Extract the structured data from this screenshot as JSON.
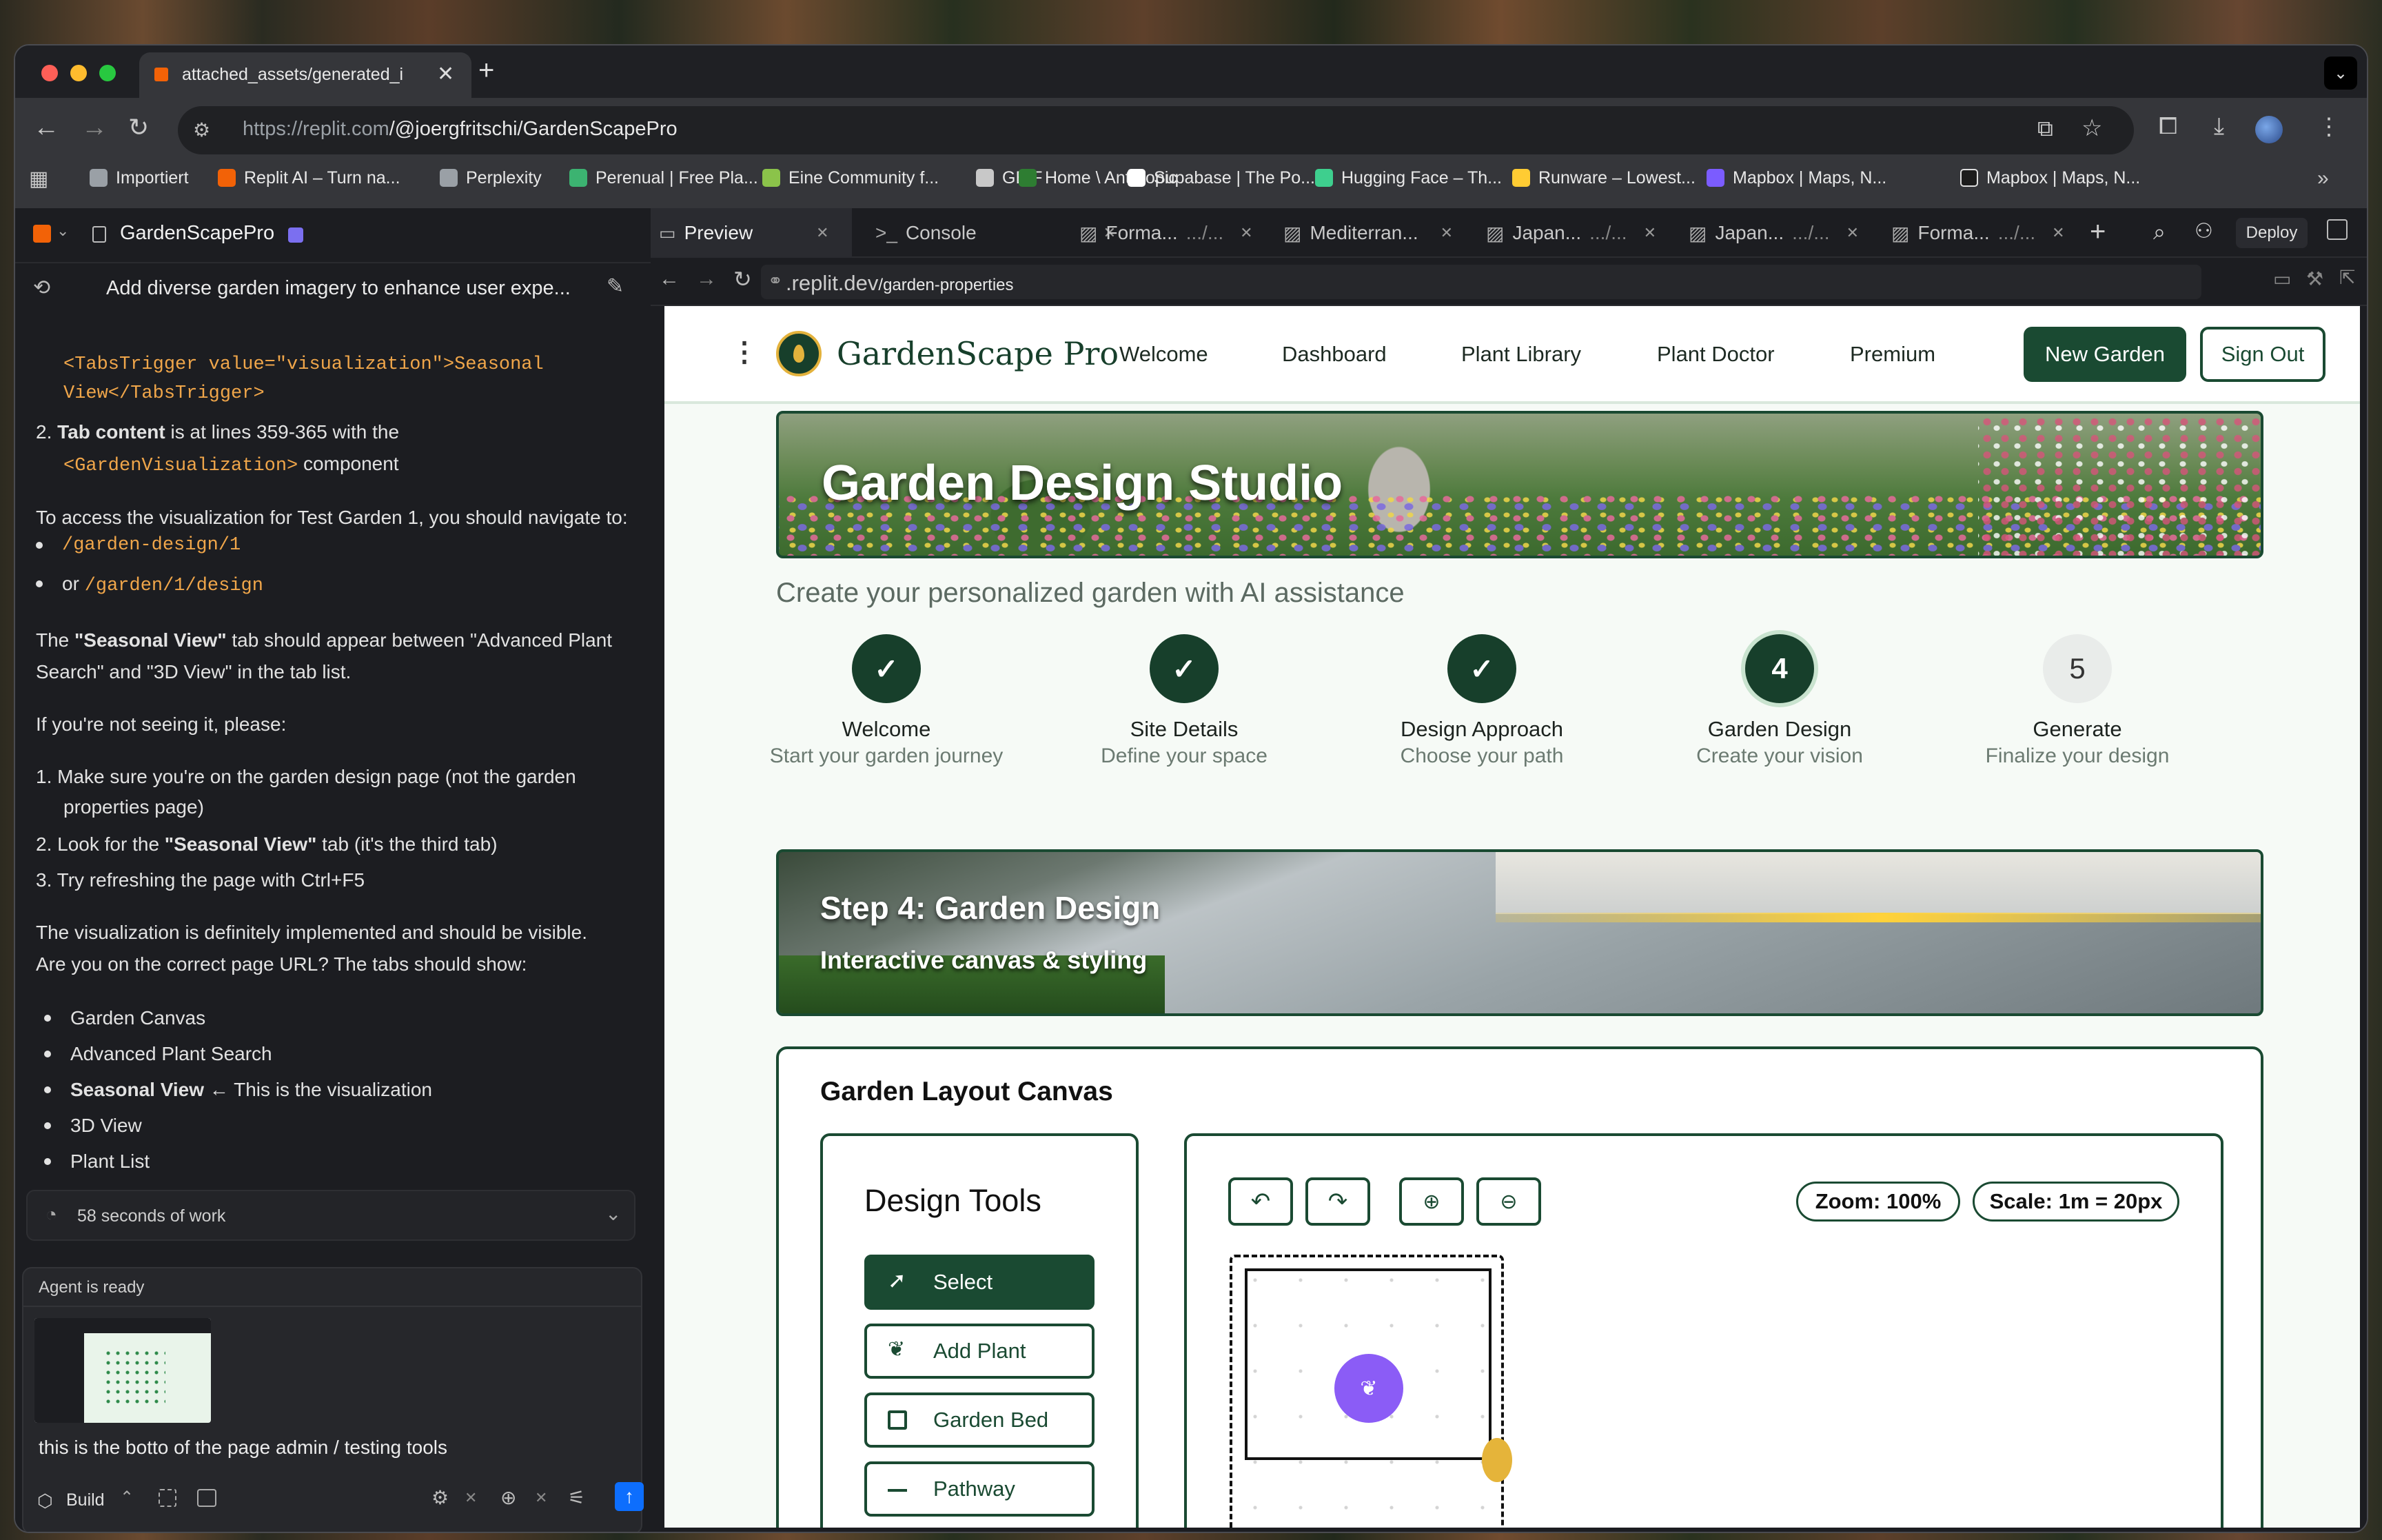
{
  "browser": {
    "tab_title": "attached_assets/generated_i",
    "url_host": "https://replit.com",
    "url_path": "/@joergfritschi/GardenScapePro",
    "bookmarks": [
      "Importiert",
      "Replit AI – Turn na...",
      "Perplexity",
      "Perenual | Free Pla...",
      "Eine Community f...",
      "GBIF",
      "Home \\ Anthropic",
      "Supabase | The Po...",
      "Hugging Face – Th...",
      "Runware – Lowest...",
      "Mapbox | Maps, N..."
    ]
  },
  "workspace": {
    "project_name": "GardenScapePro",
    "chat_title": "Add diverse garden imagery to enhance user expe...",
    "tabs": [
      {
        "label": "Preview"
      },
      {
        "label": "Console"
      },
      {
        "label": "Forma...",
        "suffix": ".../..."
      },
      {
        "label": "Mediterran..."
      },
      {
        "label": "Japan...",
        "suffix": ".../..."
      },
      {
        "label": "Japan...",
        "suffix": ".../..."
      },
      {
        "label": "Forma...",
        "suffix": ".../..."
      }
    ],
    "deploy_label": "Deploy",
    "preview_url_host": ".replit.dev",
    "preview_url_path": "/garden-properties"
  },
  "chat": {
    "code_top_1": "<TabsTrigger value=\"visualization\">Seasonal",
    "code_top_2": "View</TabsTrigger>",
    "item2_num": "2.",
    "item2_bold": "Tab content",
    "item2_text": " is at lines 359-365 with the",
    "item2_code": "<GardenVisualization>",
    "item2_tail": " component",
    "p_access": "To access the visualization for Test Garden 1, you should navigate to:",
    "path1": "/garden-design/1",
    "or_label": "or",
    "path2": "/garden/1/design",
    "p_the": "The ",
    "p_seasonal_bold": "\"Seasonal View\"",
    "p_tab_text": " tab should appear between \"Advanced Plant",
    "p_tab_text2": "Search\" and \"3D View\" in the tab list.",
    "p_if": "If you're not seeing it, please:",
    "s1_num": "1.",
    "s1a": "Make sure you're on the garden design page (not the garden",
    "s1b": "properties page)",
    "s2_num": "2.",
    "s2_pre": "Look for the ",
    "s2_bold": "\"Seasonal View\"",
    "s2_post": " tab (it's the third tab)",
    "s3_num": "3.",
    "s3": "Try refreshing the page with Ctrl+F5",
    "p_vis1": "The visualization is definitely implemented and should be visible.",
    "p_vis2": "Are you on the correct page URL? The tabs should show:",
    "tabs_list": [
      "Garden Canvas",
      "Advanced Plant Search"
    ],
    "seasonal_bold": "Seasonal View",
    "seasonal_note": " ← This is the visualization",
    "tabs_list2": [
      "3D View",
      "Plant List"
    ],
    "work_label": "58 seconds of work",
    "agent_ready": "Agent is ready",
    "input_text": "this is the botto of the page admin / testing tools",
    "build_label": "Build"
  },
  "site": {
    "brand": "GardenScape Pro",
    "nav": [
      "Welcome",
      "Dashboard",
      "Plant Library",
      "Plant Doctor",
      "Premium"
    ],
    "new_garden": "New Garden",
    "sign_out": "Sign Out",
    "hero_title": "Garden Design Studio",
    "subtitle": "Create your personalized garden with AI assistance",
    "steps": [
      {
        "marker": "✓",
        "title": "Welcome",
        "sub": "Start your garden journey"
      },
      {
        "marker": "✓",
        "title": "Site Details",
        "sub": "Define your space"
      },
      {
        "marker": "✓",
        "title": "Design Approach",
        "sub": "Choose your path"
      },
      {
        "marker": "4",
        "title": "Garden Design",
        "sub": "Create your vision"
      },
      {
        "marker": "5",
        "title": "Generate",
        "sub": "Finalize your design"
      }
    ],
    "step_banner_title": "Step 4: Garden Design",
    "step_banner_sub": "Interactive canvas & styling",
    "canvas_card_title": "Garden Layout Canvas",
    "tools_title": "Design Tools",
    "tools": [
      "Select",
      "Add Plant",
      "Garden Bed",
      "Pathway"
    ],
    "zoom": "Zoom: 100%",
    "scale": "Scale: 1m = 20px"
  }
}
